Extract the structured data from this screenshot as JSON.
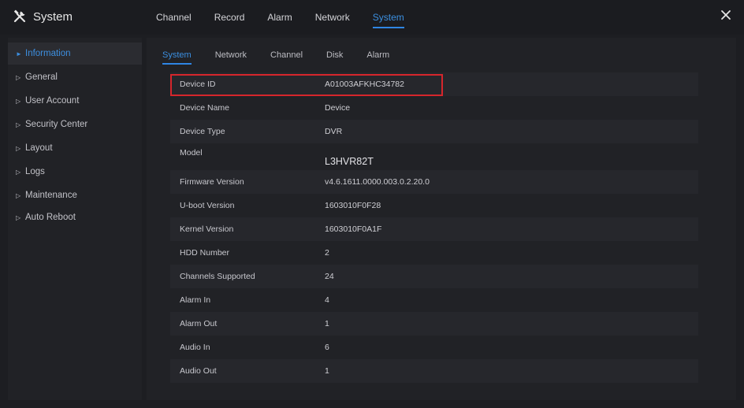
{
  "app": {
    "title": "System"
  },
  "top_tabs": [
    {
      "label": "Channel"
    },
    {
      "label": "Record"
    },
    {
      "label": "Alarm"
    },
    {
      "label": "Network"
    },
    {
      "label": "System"
    }
  ],
  "top_tab_active": "System",
  "sidebar": {
    "items": [
      {
        "label": "Information"
      },
      {
        "label": "General"
      },
      {
        "label": "User Account"
      },
      {
        "label": "Security Center"
      },
      {
        "label": "Layout"
      },
      {
        "label": "Logs"
      },
      {
        "label": "Maintenance"
      },
      {
        "label": "Auto Reboot"
      }
    ]
  },
  "sub_tabs": [
    {
      "label": "System"
    },
    {
      "label": "Network"
    },
    {
      "label": "Channel"
    },
    {
      "label": "Disk"
    },
    {
      "label": "Alarm"
    }
  ],
  "info": {
    "rows": [
      {
        "label": "Device ID",
        "value": "A01003AFKHC34782"
      },
      {
        "label": "Device Name",
        "value": "Device"
      },
      {
        "label": "Device Type",
        "value": "DVR"
      },
      {
        "label": "Model",
        "value": "L3HVR82T"
      },
      {
        "label": "Firmware Version",
        "value": "v4.6.1611.0000.003.0.2.20.0"
      },
      {
        "label": "U-boot Version",
        "value": "1603010F0F28"
      },
      {
        "label": "Kernel Version",
        "value": "1603010F0A1F"
      },
      {
        "label": "HDD Number",
        "value": "2"
      },
      {
        "label": "Channels Supported",
        "value": "24"
      },
      {
        "label": "Alarm In",
        "value": "4"
      },
      {
        "label": "Alarm Out",
        "value": "1"
      },
      {
        "label": "Audio In",
        "value": "6"
      },
      {
        "label": "Audio Out",
        "value": "1"
      }
    ]
  },
  "colors": {
    "accent": "#2f86e4",
    "highlight": "#d6262c",
    "background": "#1d1e22"
  },
  "icons": {
    "app": "tools-icon",
    "close": "close-icon",
    "bullet": "triangle-right-icon"
  }
}
